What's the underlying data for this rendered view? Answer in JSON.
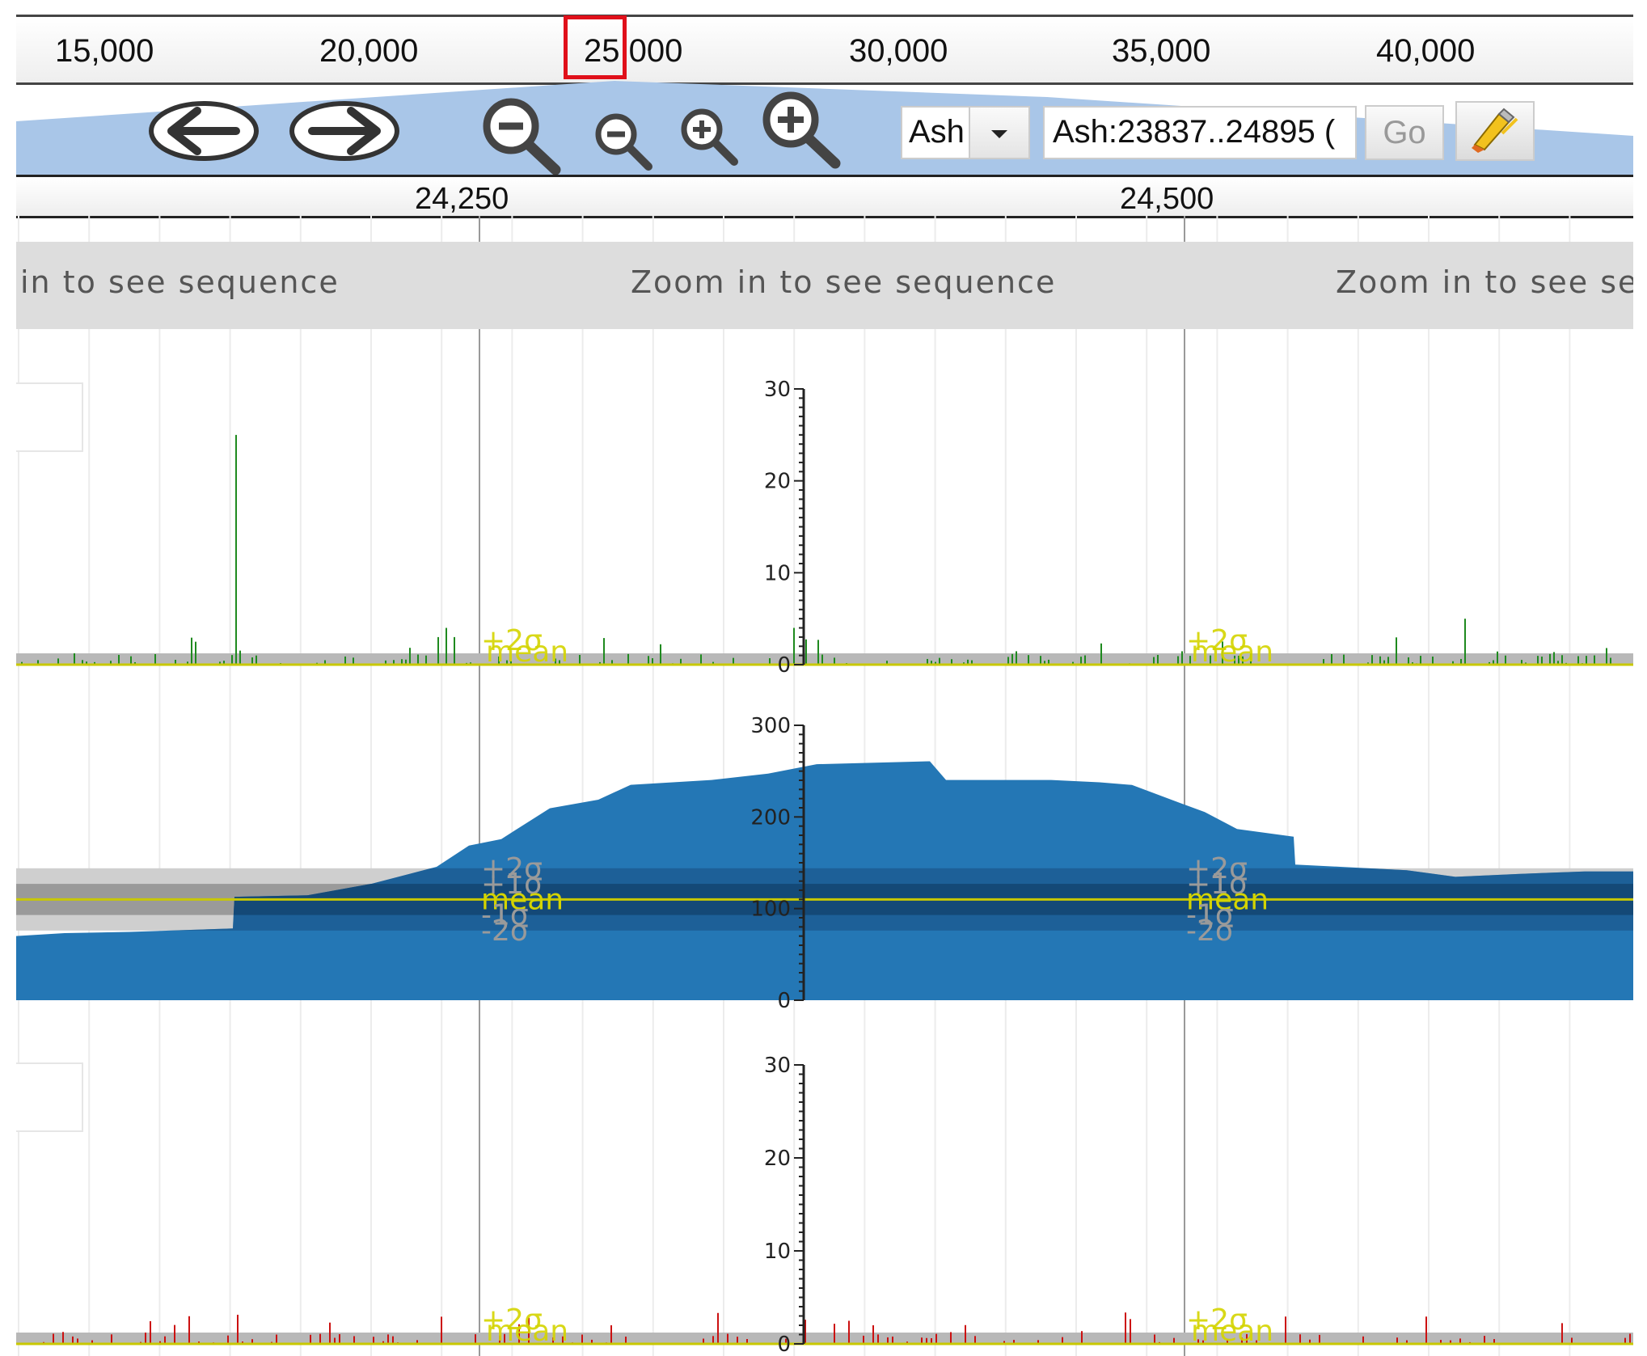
{
  "overview_ruler": {
    "ticks": [
      "15,000",
      "20,000",
      "25,000",
      "30,000",
      "35,000",
      "40,000"
    ],
    "highlight_marker_color": "#e0101a",
    "region_color": "#a9c6e8"
  },
  "navigation": {
    "icons": [
      "arrow-left-icon",
      "arrow-right-icon",
      "zoom-out-large-icon",
      "zoom-out-small-icon",
      "zoom-in-small-icon",
      "zoom-in-large-icon",
      "highlighter-icon"
    ],
    "reference_select": {
      "value": "Ash"
    },
    "location_input": {
      "value": "Ash:23837..24895 ("
    },
    "go_label": "Go"
  },
  "detail_ruler": {
    "ticks": [
      "24,250",
      "24,500"
    ]
  },
  "sequence_track": {
    "messages": [
      "in to see sequence",
      "Zoom in to see sequence",
      "Zoom in to see seq"
    ]
  },
  "tracks": [
    {
      "name": "top-bar-track",
      "color": "#1f8a1f",
      "axis_ticks": [
        "30",
        "20",
        "10",
        "0"
      ],
      "stat_labels": [
        "+2σ",
        "mean"
      ]
    },
    {
      "name": "coverage-track",
      "color": "#2477b5",
      "axis_ticks": [
        "300",
        "200",
        "100",
        "0"
      ],
      "stat_labels": [
        "+2σ",
        "+1σ",
        "mean",
        "-1σ",
        "-2σ"
      ]
    },
    {
      "name": "bottom-bar-track",
      "color": "#cc1111",
      "axis_ticks": [
        "30",
        "20",
        "10",
        "0"
      ],
      "stat_labels": [
        "+2σ",
        "mean"
      ]
    }
  ],
  "colors": {
    "mean_line": "#c8c800",
    "stat_text": "#d4d400",
    "band_gray": "#9a9a9a"
  }
}
